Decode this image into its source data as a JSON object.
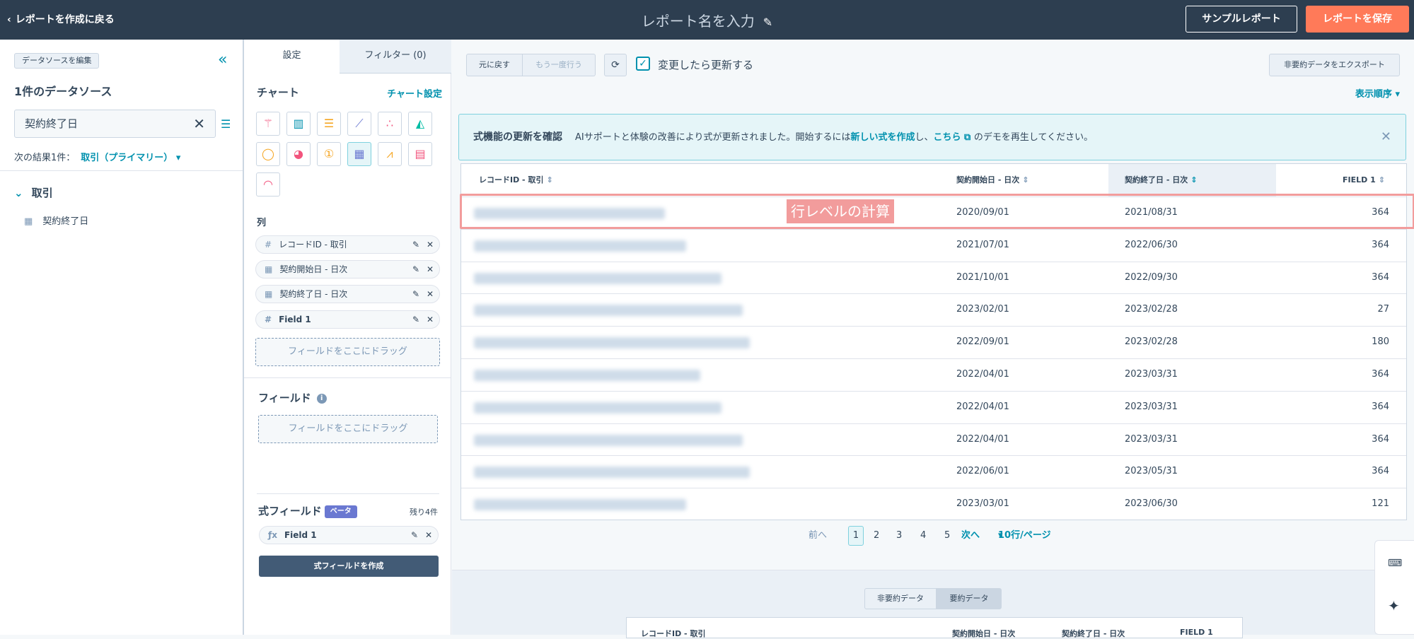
{
  "header": {
    "back": "レポートを作成に戻る",
    "title": "レポート名を入力",
    "sample": "サンプルレポート",
    "save": "レポートを保存"
  },
  "left": {
    "edit_source": "データソースを編集",
    "source_count": "1件のデータソース",
    "search_value": "契約終了日",
    "next_results": "次の結果1件：",
    "next_results_link": "取引（プライマリー）",
    "group": "取引",
    "field": "契約終了日"
  },
  "middle": {
    "tab_settings": "設定",
    "tab_filters": "フィルター (0)",
    "chart_title": "チャート",
    "chart_settings": "チャート設定",
    "columns_title": "列",
    "columns": [
      {
        "type": "#",
        "label": "レコードID - 取引"
      },
      {
        "type": "cal",
        "label": "契約開始日 - 日次"
      },
      {
        "type": "cal",
        "label": "契約終了日 - 日次"
      },
      {
        "type": "#",
        "label": "Field 1"
      }
    ],
    "drop": "フィールドをここにドラッグ",
    "fields_title": "フィールド",
    "fields_drop": "フィールドをここにドラッグ",
    "formula_title": "式フィールド",
    "beta": "ベータ",
    "remaining": "残り4件",
    "formula_field": "Field 1",
    "create_formula": "式フィールドを作成"
  },
  "toolbar": {
    "undo": "元に戻す",
    "redo": "もう一度行う",
    "auto_refresh": "変更したら更新する",
    "export": "非要約データをエクスポート",
    "sort_order": "表示順序"
  },
  "banner": {
    "title": "式機能の更新を確認",
    "text1": "AIサポートと体験の改善により式が更新されました。開始するには",
    "link1": "新しい式を作成",
    "text2": "し、",
    "link2": "こちら",
    "text3": "のデモを再生してください。"
  },
  "table": {
    "headers": [
      "レコードID - 取引",
      "契約開始日 - 日次",
      "契約終了日 - 日次",
      "FIELD 1"
    ],
    "rows": [
      [
        "2020/09/01",
        "2021/08/31",
        "364"
      ],
      [
        "2021/07/01",
        "2022/06/30",
        "364"
      ],
      [
        "2021/10/01",
        "2022/09/30",
        "364"
      ],
      [
        "2023/02/01",
        "2023/02/28",
        "27"
      ],
      [
        "2022/09/01",
        "2023/02/28",
        "180"
      ],
      [
        "2022/04/01",
        "2023/03/31",
        "364"
      ],
      [
        "2022/04/01",
        "2023/03/31",
        "364"
      ],
      [
        "2022/04/01",
        "2023/03/31",
        "364"
      ],
      [
        "2022/06/01",
        "2023/05/31",
        "364"
      ],
      [
        "2023/03/01",
        "2023/06/30",
        "121"
      ]
    ]
  },
  "annotation": "行レベルの計算",
  "pager": {
    "prev": "前へ",
    "pages": [
      "1",
      "2",
      "3",
      "4",
      "5"
    ],
    "next": "次へ",
    "per_page": "10行/ページ"
  },
  "summary": {
    "unsummarized": "非要約データ",
    "summarized": "要約データ",
    "headers": [
      "レコードID - 取引",
      "契約開始日 - 日次",
      "契約終了日 - 日次",
      "FIELD 1"
    ]
  },
  "colors": {
    "header_bg": "#2d3e50",
    "accent": "#0091ae",
    "save": "#ff7a59",
    "highlight": "#f29c9c"
  }
}
